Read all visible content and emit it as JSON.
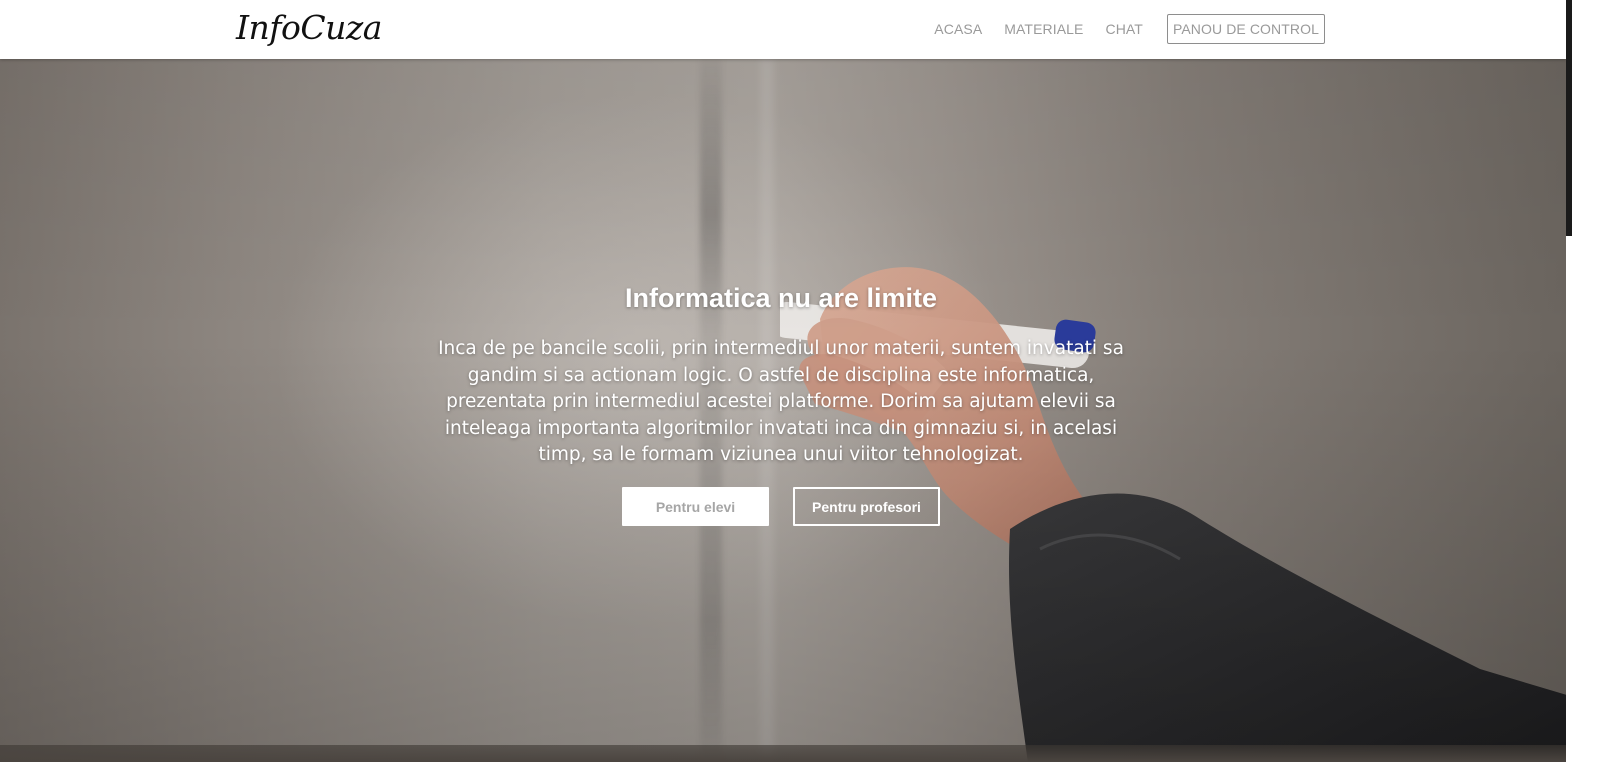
{
  "navbar": {
    "brand": "InfoCuza",
    "links": [
      {
        "label": "ACASA"
      },
      {
        "label": "MATERIALE"
      },
      {
        "label": "CHAT"
      },
      {
        "label": "PANOU DE CONTROL"
      }
    ]
  },
  "hero": {
    "title": "Informatica nu are limite",
    "text": "Inca de pe bancile scolii, prin intermediul unor materii, suntem invatati sa gandim si sa actionam logic. O astfel de disciplina este informatica, prezentata prin intermediul acestei platforme. Dorim sa ajutam elevii sa inteleaga importanta algoritmilor invatati inca din gimnaziu si, in acelasi timp, sa le formam viziunea unui viitor tehnologizat.",
    "buttons": {
      "students": "Pentru elevi",
      "teachers": "Pentru profesori"
    },
    "background_image": "hand-writing-with-marker-on-whiteboard"
  },
  "colors": {
    "nav_link": "#9a9a9a",
    "brand": "#111111",
    "hero_text": "#ffffff",
    "primary_button_text": "#a6a6a6"
  }
}
